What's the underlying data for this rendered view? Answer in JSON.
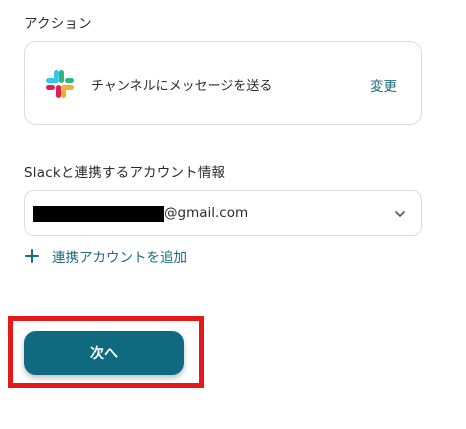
{
  "action_section": {
    "label": "アクション",
    "action_name": "チャンネルにメッセージを送る",
    "change_label": "変更"
  },
  "account_section": {
    "label": "Slackと連携するアカウント情報",
    "selected_account_suffix": "@gmail.com",
    "add_account_label": "連携アカウントを追加"
  },
  "footer": {
    "next_label": "次へ"
  },
  "colors": {
    "accent": "#1b6a80",
    "button": "#0f6a80",
    "highlight": "#e3191c",
    "slack_blue": "#36c5f0",
    "slack_green": "#2eb67d",
    "slack_yellow": "#ecb22e",
    "slack_red": "#e01e5a"
  },
  "icons": {
    "app": "slack-icon",
    "dropdown": "chevron-down-icon",
    "add": "plus-icon"
  }
}
